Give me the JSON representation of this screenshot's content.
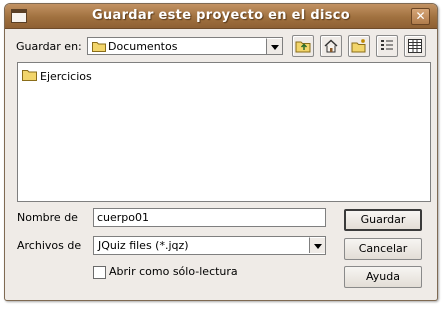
{
  "window": {
    "title": "Guardar este proyecto en el disco",
    "close_glyph": "✕"
  },
  "lookin": {
    "label": "Guardar en:",
    "value": "Documentos"
  },
  "toolbar": {
    "buttons": [
      {
        "name": "up-folder-icon"
      },
      {
        "name": "home-icon"
      },
      {
        "name": "new-folder-icon"
      },
      {
        "name": "list-view-icon"
      },
      {
        "name": "details-view-icon"
      }
    ]
  },
  "files": [
    {
      "name": "Ejercicios",
      "type": "folder"
    }
  ],
  "filename": {
    "label": "Nombre de",
    "value": "cuerpo01"
  },
  "filetype": {
    "label": "Archivos de",
    "value": "JQuiz files (*.jqz)"
  },
  "readonly": {
    "label": "Abrir como sólo-lectura",
    "checked": false
  },
  "buttons": {
    "save": "Guardar",
    "cancel": "Cancelar",
    "help": "Ayuda"
  },
  "colors": {
    "titlebar": "#a0713f",
    "window_bg": "#efebe7",
    "folder": "#f2d56b"
  }
}
